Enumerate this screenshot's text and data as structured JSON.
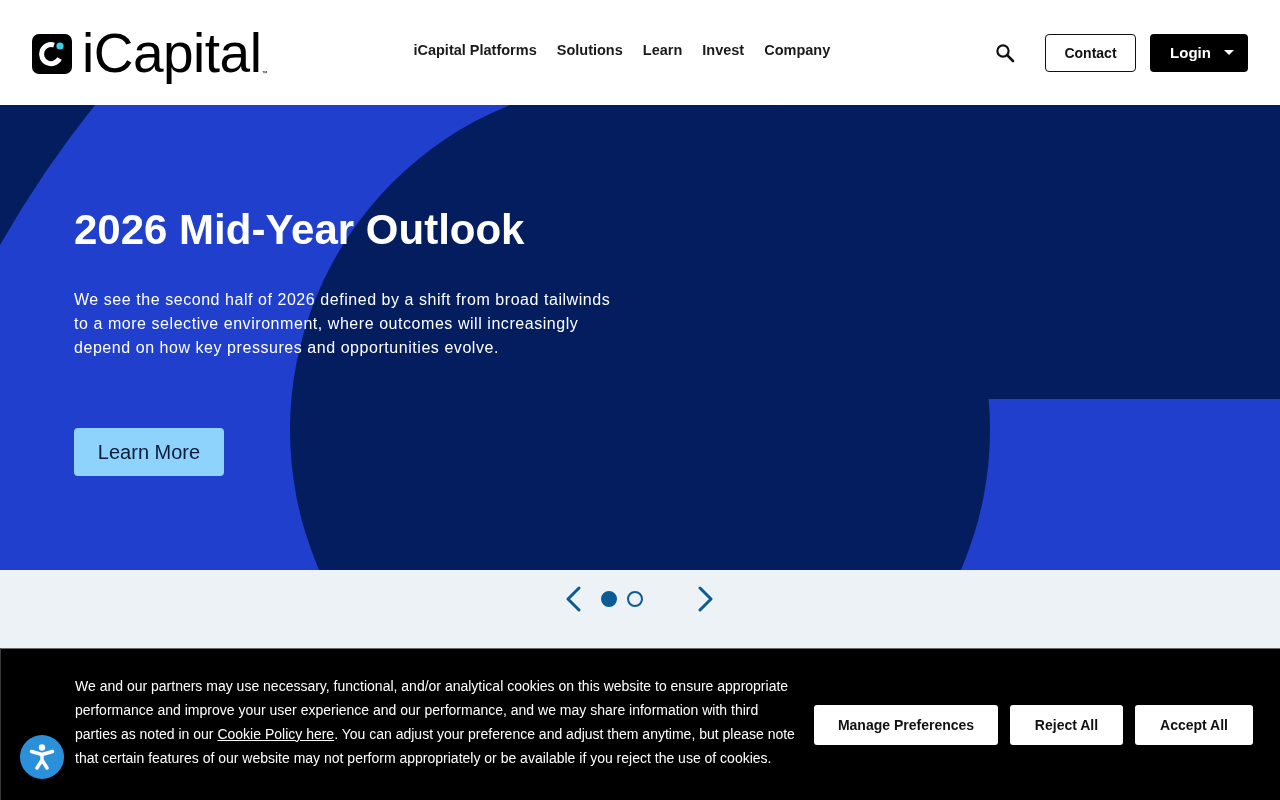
{
  "header": {
    "logo": {
      "text": "iCapital",
      "trademark": "™"
    },
    "nav": [
      "iCapital Platforms",
      "Solutions",
      "Learn",
      "Invest",
      "Company"
    ],
    "buttons": {
      "contact": "Contact",
      "login": "Login"
    }
  },
  "hero": {
    "title": "2026 Mid-Year Outlook",
    "description": "We see the second half of 2026 defined by a shift from broad tailwinds to a more selective environment, where outcomes will increasingly depend on how key pressures and opportunities evolve.",
    "button": "Learn More"
  },
  "carousel": {
    "slides": [
      {
        "selected": true
      },
      {
        "selected": false
      }
    ]
  },
  "cookie_banner": {
    "text_before": "We and our partners may use necessary, functional, and/or analytical cookies on this website to ensure appropriate performance and improve your user experience and our performance, and we may share information with third parties as noted in our ",
    "link": "Cookie Policy here",
    "text_after": ". You can adjust your preference and adjust them anytime, but please note that certain features of our website may not perform appropriately or be available if you reject the use of cookies.",
    "buttons": [
      "Manage Preferences",
      "Reject All",
      "Accept All"
    ]
  }
}
